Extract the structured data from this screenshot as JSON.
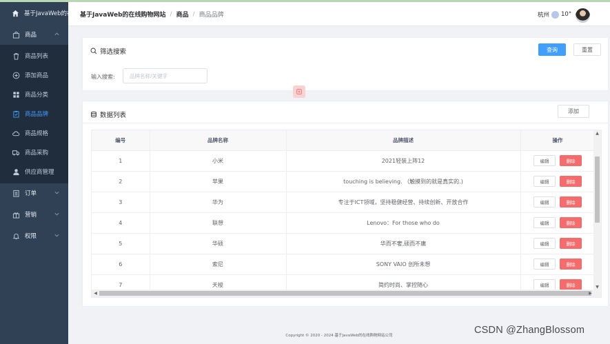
{
  "sidebar": {
    "home": "基于JavaWeb的在",
    "goods_menu": "商品",
    "items": [
      {
        "label": "商品列表",
        "icon": "trash-icon"
      },
      {
        "label": "添加商品",
        "icon": "plus-circle-icon"
      },
      {
        "label": "商品分类",
        "icon": "grid-icon"
      },
      {
        "label": "商品品牌",
        "icon": "clipboard-icon"
      },
      {
        "label": "商品规格",
        "icon": "cloud-icon"
      },
      {
        "label": "商品采购",
        "icon": "truck-icon"
      },
      {
        "label": "供应商管理",
        "icon": "user-icon"
      }
    ],
    "order_menu": "订单",
    "marketing_menu": "营销",
    "permission_menu": "权限",
    "active_color": "#409eff",
    "bg_color": "#304156"
  },
  "header": {
    "breadcrumb": [
      "基于JavaWeb的在线购物网站",
      "商品",
      "商品品牌"
    ],
    "separator": "/",
    "city": "杭州",
    "temp": "10°"
  },
  "filter": {
    "title": "筛选搜索",
    "search_button": "查询",
    "reset_button": "重置",
    "search_label": "输入搜索:",
    "search_placeholder": "品牌名称/关键字"
  },
  "list": {
    "title": "数据列表",
    "add_button": "添加",
    "columns": [
      "编号",
      "品牌名称",
      "品牌描述",
      "操作"
    ],
    "edit_label": "编辑",
    "delete_label": "删除",
    "rows": [
      {
        "id": "1",
        "name": "小米",
        "desc": "2021轻装上阵12"
      },
      {
        "id": "2",
        "name": "苹果",
        "desc": "touching is believing. （触摸到的就是真实的.)"
      },
      {
        "id": "3",
        "name": "华为",
        "desc": "专注于ICT领域，坚持稳健经营、持续创新、开放合作"
      },
      {
        "id": "4",
        "name": "联想",
        "desc": "Lenovo：For those who do"
      },
      {
        "id": "5",
        "name": "华硕",
        "desc": "华而不奢,硕而不庸"
      },
      {
        "id": "6",
        "name": "索尼",
        "desc": "SONY VAIO 创所未想"
      },
      {
        "id": "7",
        "name": "天梭",
        "desc": "简约时尚、掌控随心"
      }
    ]
  },
  "footer": {
    "copyright": "Copyright © 2020 - 2024   基于JavaWeb的在线购物网站公司"
  },
  "watermark": "CSDN @ZhangBlossom"
}
